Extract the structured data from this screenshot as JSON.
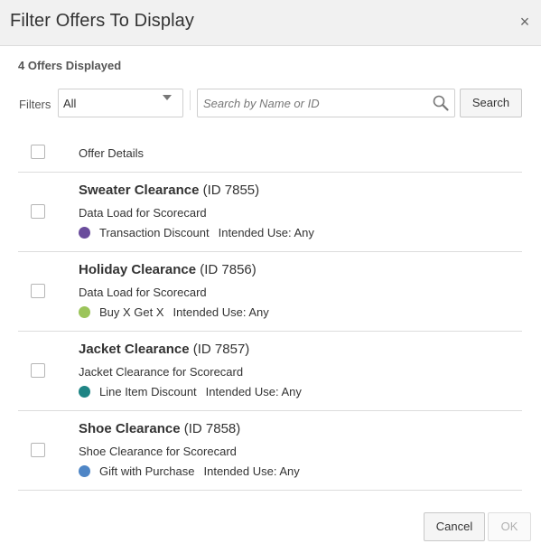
{
  "dialog": {
    "title": "Filter Offers To Display",
    "close_glyph": "×",
    "count_text": "4 Offers Displayed"
  },
  "filters": {
    "label": "Filters",
    "selected": "All",
    "search_placeholder": "Search by Name or ID",
    "search_value": "",
    "search_button": "Search"
  },
  "table": {
    "header": "Offer Details",
    "rows": [
      {
        "name": "Sweater Clearance",
        "id": "(ID 7855)",
        "description": "Data Load for Scorecard",
        "type": "Transaction Discount",
        "use": "Intended Use: Any",
        "color": "#6a4c9c"
      },
      {
        "name": "Holiday Clearance",
        "id": "(ID 7856)",
        "description": "Data Load for Scorecard",
        "type": "Buy X Get X",
        "use": "Intended Use: Any",
        "color": "#9bc45a"
      },
      {
        "name": "Jacket Clearance",
        "id": "(ID 7857)",
        "description": "Jacket Clearance for Scorecard",
        "type": "Line Item Discount",
        "use": "Intended Use: Any",
        "color": "#1f8585"
      },
      {
        "name": "Shoe Clearance",
        "id": "(ID 7858)",
        "description": "Shoe Clearance for Scorecard",
        "type": "Gift with Purchase",
        "use": "Intended Use: Any",
        "color": "#4f86c6"
      }
    ]
  },
  "footer": {
    "cancel": "Cancel",
    "ok": "OK"
  }
}
